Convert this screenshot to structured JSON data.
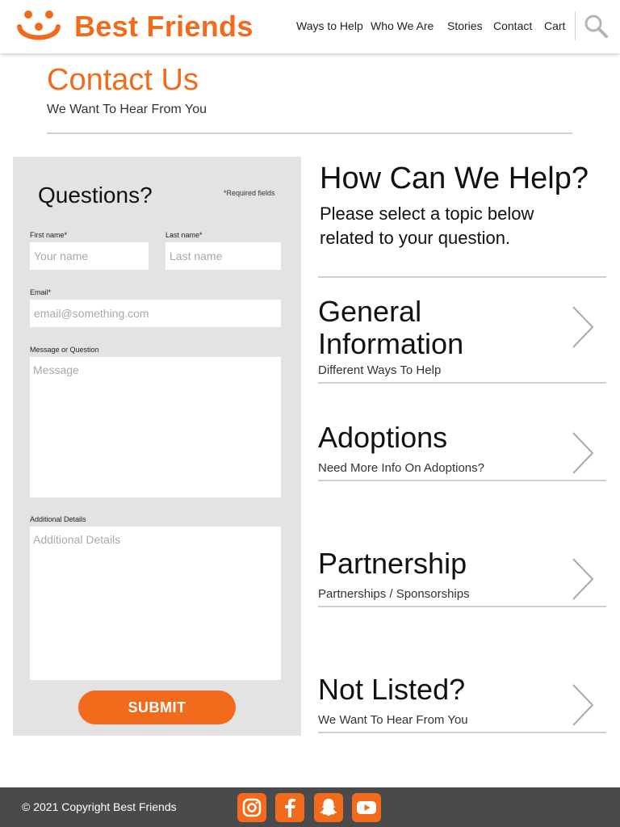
{
  "header": {
    "brand": "Best Friends",
    "nav": [
      "Ways to Help",
      "Who We Are",
      "Stories",
      "Contact",
      "Cart"
    ]
  },
  "page": {
    "title": "Contact Us",
    "subtitle": "We Want To Hear From You"
  },
  "form": {
    "title": "Questions?",
    "required_note": "*Required fields",
    "first_name_label": "First name*",
    "first_name_placeholder": "Your name",
    "last_name_label": "Last name*",
    "last_name_placeholder": "Last name",
    "email_label": "Email*",
    "email_placeholder": "email@something.com",
    "message_label": "Message or Question",
    "message_placeholder": "Message",
    "details_label": "Additional Details",
    "details_placeholder": "Additional Details",
    "submit_label": "SUBMIT"
  },
  "help": {
    "title": "How Can We Help?",
    "subtitle": "Please select a topic below related to your question.",
    "topics": [
      {
        "title": "General Information",
        "subtitle": "Different Ways To Help"
      },
      {
        "title": "Adoptions",
        "subtitle": "Need More Info On Adoptions?"
      },
      {
        "title": "Partnership",
        "subtitle": "Partnerships / Sponsorships"
      },
      {
        "title": "Not Listed?",
        "subtitle": "We Want To Hear From You"
      }
    ]
  },
  "footer": {
    "copyright": "© 2021 Copyright Best Friends",
    "social": [
      "instagram-icon",
      "facebook-icon",
      "snapchat-icon",
      "youtube-icon"
    ]
  },
  "colors": {
    "accent": "#f26b1d",
    "panel": "#e3e3e3",
    "footer": "#4a4a4a"
  }
}
